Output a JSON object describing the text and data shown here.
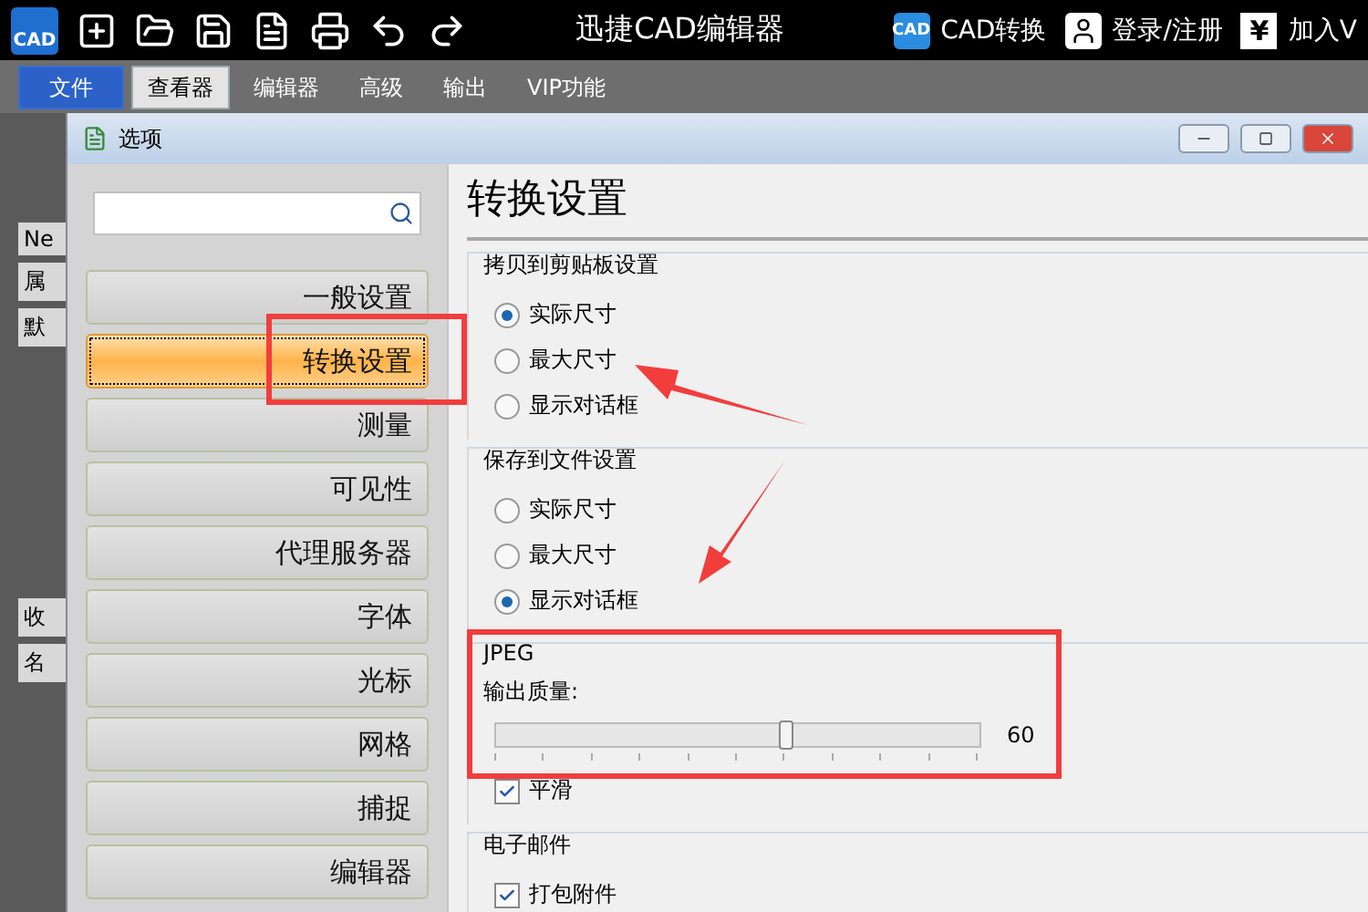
{
  "app": {
    "logo": "CAD",
    "title": "迅捷CAD编辑器",
    "convert": {
      "icon_text": "CAD",
      "label": "CAD转换"
    },
    "login": "登录/注册",
    "vip": {
      "icon_text": "¥",
      "label": "加入V"
    }
  },
  "ribbon_tabs": [
    {
      "label": "文件",
      "selected": false,
      "kind": "file"
    },
    {
      "label": "查看器",
      "selected": true,
      "kind": "tab"
    },
    {
      "label": "编辑器",
      "selected": false,
      "kind": "tab"
    },
    {
      "label": "高级",
      "selected": false,
      "kind": "tab"
    },
    {
      "label": "输出",
      "selected": false,
      "kind": "tab"
    },
    {
      "label": "VIP功能",
      "selected": false,
      "kind": "tab"
    }
  ],
  "background_panel": {
    "tab": "Ne",
    "properties": "属",
    "default": "默",
    "favorites": "收",
    "name": "名"
  },
  "dialog": {
    "title": "选项",
    "nav": [
      {
        "label": "一般设置",
        "selected": false
      },
      {
        "label": "转换设置",
        "selected": true
      },
      {
        "label": "测量",
        "selected": false
      },
      {
        "label": "可见性",
        "selected": false
      },
      {
        "label": "代理服务器",
        "selected": false
      },
      {
        "label": "字体",
        "selected": false
      },
      {
        "label": "光标",
        "selected": false
      },
      {
        "label": "网格",
        "selected": false
      },
      {
        "label": "捕捉",
        "selected": false
      },
      {
        "label": "编辑器",
        "selected": false
      }
    ],
    "heading": "转换设置",
    "groups": [
      {
        "title": "拷贝到剪贴板设置",
        "options": [
          {
            "label": "实际尺寸",
            "selected": true
          },
          {
            "label": "最大尺寸",
            "selected": false
          },
          {
            "label": "显示对话框",
            "selected": false
          }
        ]
      },
      {
        "title": "保存到文件设置",
        "options": [
          {
            "label": "实际尺寸",
            "selected": false
          },
          {
            "label": "最大尺寸",
            "selected": false
          },
          {
            "label": "显示对话框",
            "selected": true
          }
        ]
      }
    ],
    "jpeg": {
      "title": "JPEG",
      "quality_label": "输出质量:",
      "level": 0.6,
      "reading": "60",
      "smooth": {
        "label": "平滑",
        "checked": true
      }
    },
    "email": {
      "title": "电子邮件",
      "pack": {
        "label": "打包附件",
        "checked": true
      }
    }
  }
}
